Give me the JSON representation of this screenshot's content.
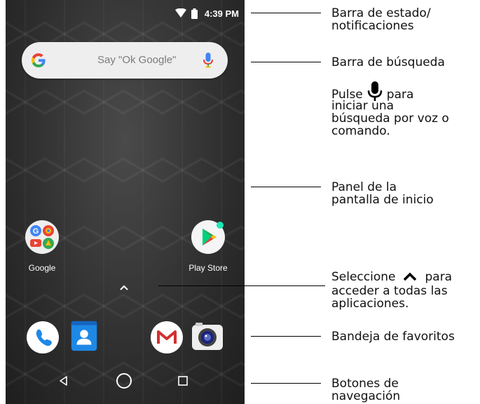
{
  "status_bar": {
    "time": "4:39 PM",
    "icons": [
      "wifi-icon",
      "battery-icon"
    ]
  },
  "search_bar": {
    "placeholder": "Say \"Ok Google\"",
    "icons": [
      "google-g-icon",
      "microphone-icon"
    ]
  },
  "home_apps": [
    {
      "label": "Google",
      "icon": "google-folder-icon"
    },
    {
      "label": "Play Store",
      "icon": "play-store-icon"
    }
  ],
  "favorites_tray": [
    "phone-icon",
    "contacts-icon",
    "gmail-icon",
    "camera-icon"
  ],
  "navigation": [
    "back-icon",
    "home-icon",
    "recents-icon"
  ],
  "callouts": {
    "status_l1": "Barra de estado/",
    "status_l2": "notificaciones",
    "search": "Barra de búsqueda",
    "pulse_a": "Pulse",
    "pulse_b": "para",
    "pulse_l2": "iniciar una",
    "pulse_l3": "búsqueda por voz o",
    "pulse_l4": "comando.",
    "panel_l1": "Panel de la",
    "panel_l2": "pantalla de inicio",
    "select_a": "Seleccione",
    "select_b": "para",
    "select_l2": "acceder a todas las",
    "select_l3": "aplicaciones.",
    "favorites": "Bandeja de favoritos",
    "nav_l1": "Botones de",
    "nav_l2": "navegación"
  },
  "colors": {
    "google_blue": "#4285F4",
    "google_red": "#EA4335",
    "google_yellow": "#FBBC05",
    "google_green": "#34A853"
  }
}
